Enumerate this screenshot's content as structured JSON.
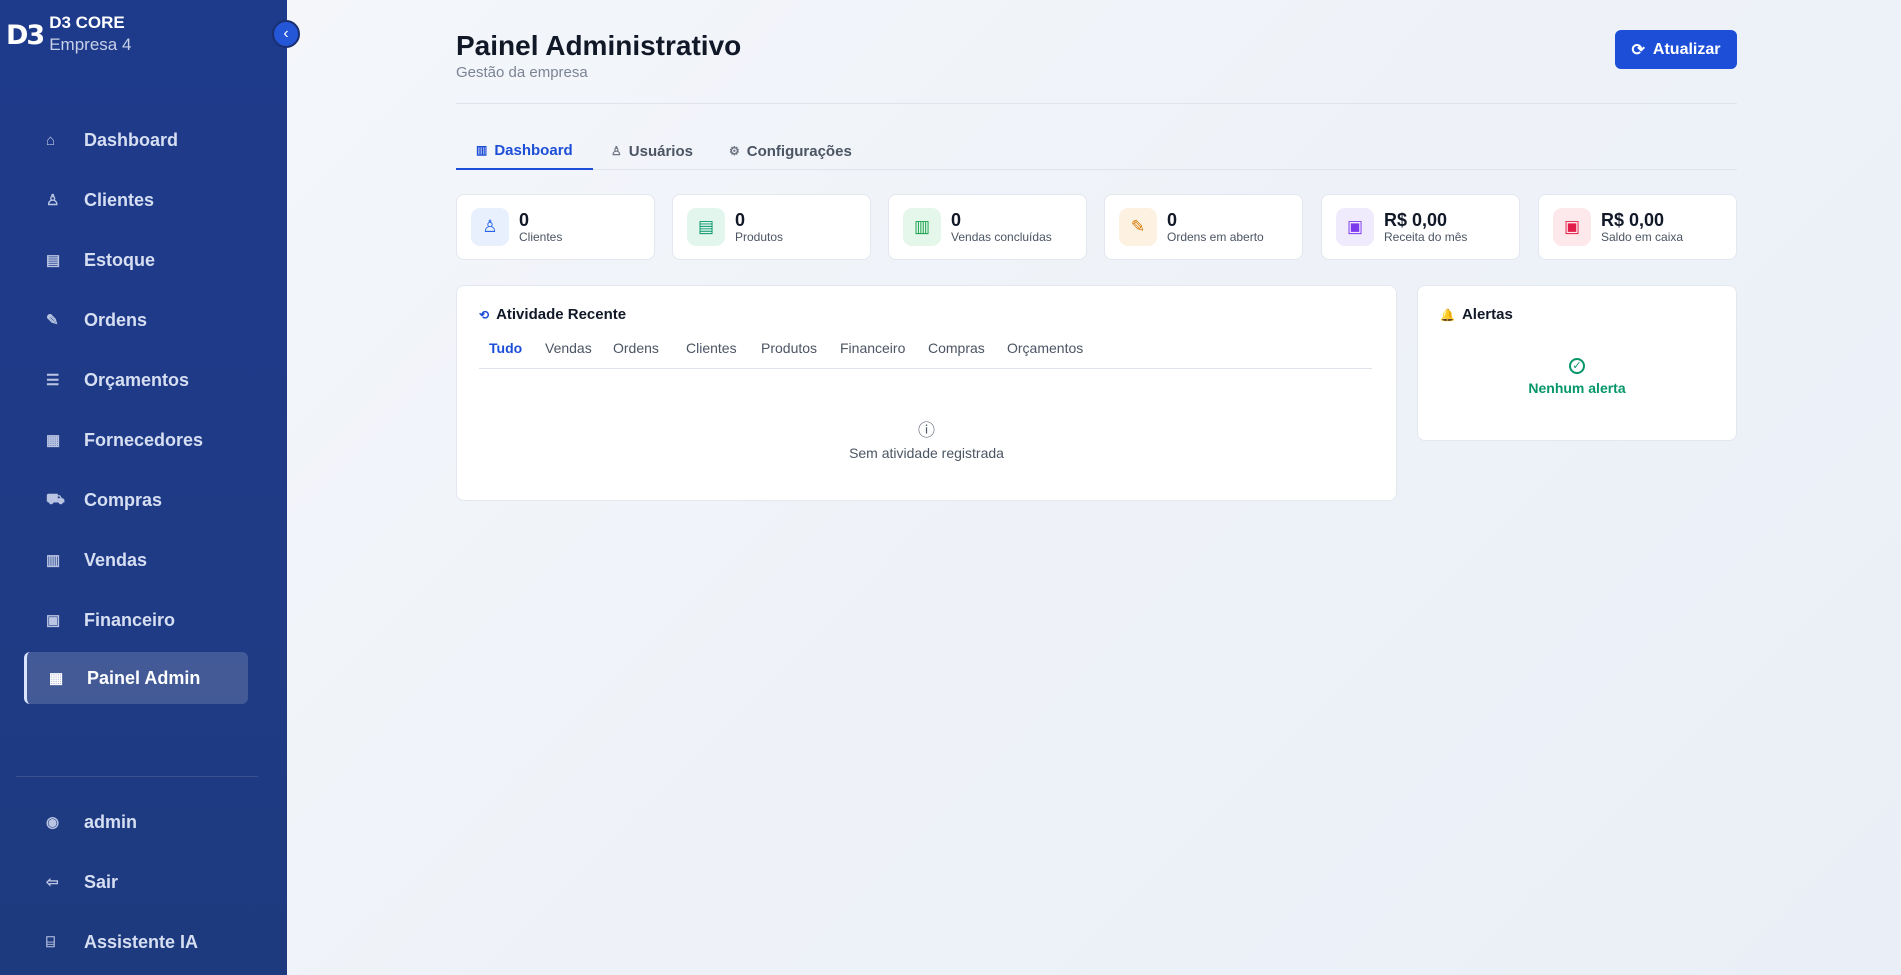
{
  "sidebar": {
    "logo": "D3",
    "title": "D3 CORE",
    "company": "Empresa 4",
    "collapse_icon": "‹",
    "items": [
      {
        "label": "Dashboard",
        "icon": "⌂"
      },
      {
        "label": "Clientes",
        "icon": "♙"
      },
      {
        "label": "Estoque",
        "icon": "▤"
      },
      {
        "label": "Ordens",
        "icon": "✎"
      },
      {
        "label": "Orçamentos",
        "icon": "☰"
      },
      {
        "label": "Fornecedores",
        "icon": "▦"
      },
      {
        "label": "Compras",
        "icon": "⛟"
      },
      {
        "label": "Vendas",
        "icon": "▥"
      },
      {
        "label": "Financeiro",
        "icon": "▣"
      },
      {
        "label": "Painel Admin",
        "icon": "▦"
      }
    ],
    "bottom": [
      {
        "label": "admin",
        "icon": "◉"
      },
      {
        "label": "Sair",
        "icon": "⇦"
      },
      {
        "label": "Assistente IA",
        "icon": "⌸"
      }
    ]
  },
  "header": {
    "title": "Painel Administrativo",
    "subtitle": "Gestão da empresa",
    "refresh_label": "Atualizar",
    "refresh_icon": "⟳"
  },
  "tabs": [
    {
      "label": "Dashboard",
      "icon": "▥"
    },
    {
      "label": "Usuários",
      "icon": "♙"
    },
    {
      "label": "Configurações",
      "icon": "⚙"
    }
  ],
  "stats": [
    {
      "value": "0",
      "label": "Clientes",
      "icon": "♙",
      "color": "#2563eb",
      "bg": "#e8effd"
    },
    {
      "value": "0",
      "label": "Produtos",
      "icon": "▤",
      "color": "#059669",
      "bg": "#e3f6ee"
    },
    {
      "value": "0",
      "label": "Vendas concluídas",
      "icon": "▥",
      "color": "#16a34a",
      "bg": "#e5f6ea"
    },
    {
      "value": "0",
      "label": "Ordens em aberto",
      "icon": "✎",
      "color": "#d97706",
      "bg": "#fdf2e2"
    },
    {
      "value": "R$ 0,00",
      "label": "Receita do mês",
      "icon": "▣",
      "color": "#7c3aed",
      "bg": "#f0eafd"
    },
    {
      "value": "R$ 0,00",
      "label": "Saldo em caixa",
      "icon": "▣",
      "color": "#e11d48",
      "bg": "#fde8ec"
    }
  ],
  "activity": {
    "title": "Atividade Recente",
    "icon": "⟲",
    "filters": [
      "Tudo",
      "Vendas",
      "Ordens",
      "Clientes",
      "Produtos",
      "Financeiro",
      "Compras",
      "Orçamentos"
    ],
    "empty_icon": "ⓘ",
    "empty_text": "Sem atividade registrada"
  },
  "alerts": {
    "title": "Alertas",
    "icon": "🔔",
    "empty_icon": "✓",
    "empty_text": "Nenhum alerta",
    "empty_color": "#059669"
  }
}
